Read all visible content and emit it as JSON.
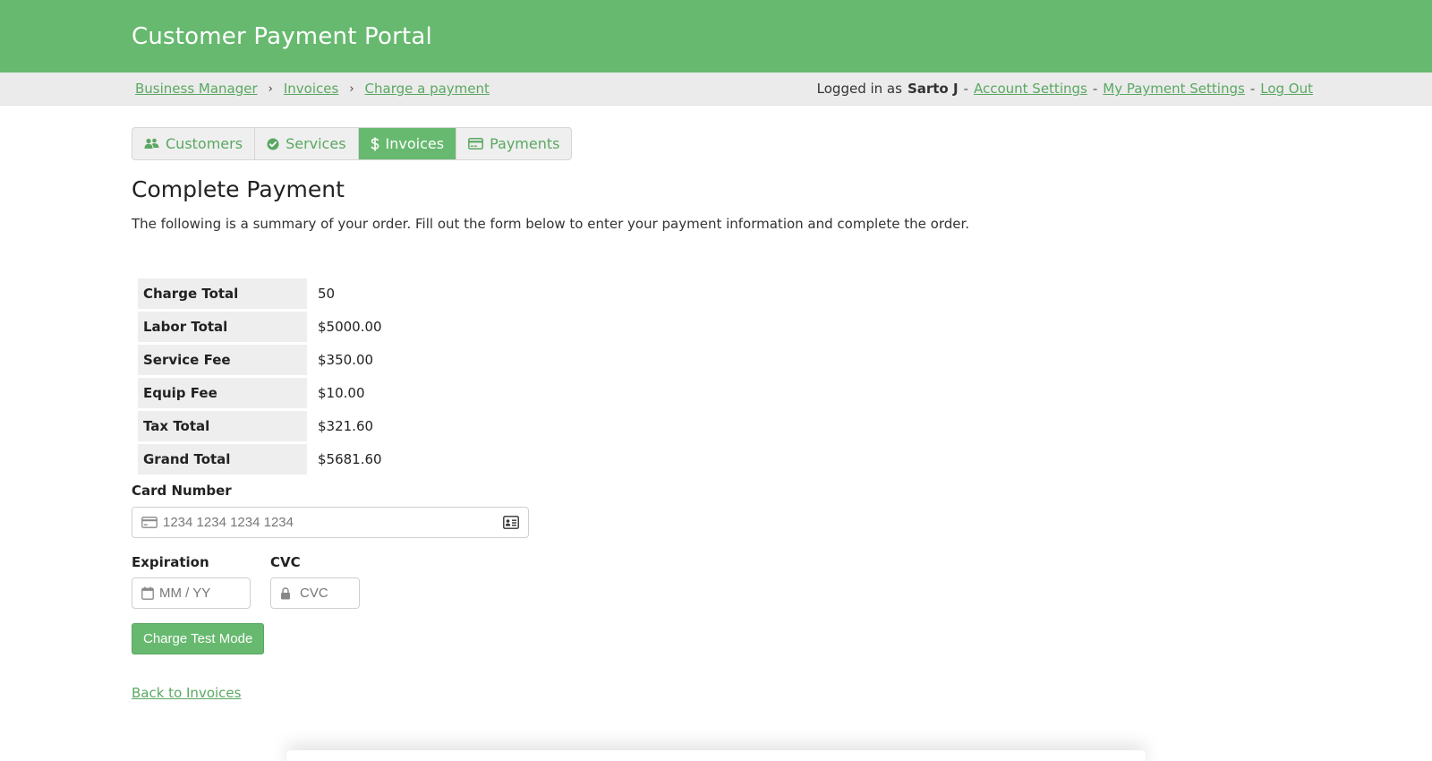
{
  "header": {
    "title": "Customer Payment Portal"
  },
  "breadcrumb": {
    "items": [
      "Business Manager",
      "Invoices",
      "Charge a payment"
    ],
    "separator": "›"
  },
  "user": {
    "prefix": "Logged in as",
    "name": "Sarto J",
    "dash": "-",
    "links": [
      "Account Settings",
      "My Payment Settings",
      "Log Out"
    ]
  },
  "tabs": [
    {
      "label": "Customers",
      "icon": "users-icon",
      "active": false
    },
    {
      "label": "Services",
      "icon": "check-circle-icon",
      "active": false
    },
    {
      "label": "Invoices",
      "icon": "dollar-icon",
      "active": true
    },
    {
      "label": "Payments",
      "icon": "credit-card-icon",
      "active": false
    }
  ],
  "main": {
    "title": "Complete Payment",
    "intro": "The following is a summary of your order. Fill out the form below to enter your payment information and complete the order."
  },
  "summary": [
    {
      "label": "Charge Total",
      "value": "50"
    },
    {
      "label": "Labor Total",
      "value": "$5000.00"
    },
    {
      "label": "Service Fee",
      "value": "$350.00"
    },
    {
      "label": "Equip Fee",
      "value": "$10.00"
    },
    {
      "label": "Tax Total",
      "value": "$321.60"
    },
    {
      "label": "Grand Total",
      "value": "$5681.60"
    }
  ],
  "form": {
    "card_label": "Card Number",
    "card_placeholder": "1234 1234 1234 1234",
    "exp_label": "Expiration",
    "exp_placeholder": "MM / YY",
    "cvc_label": "CVC",
    "cvc_placeholder": "CVC",
    "submit_label": "Charge Test Mode"
  },
  "footer": {
    "back_label": "Back to Invoices"
  },
  "colors": {
    "brand": "#67b96f",
    "link": "#5aa862"
  }
}
